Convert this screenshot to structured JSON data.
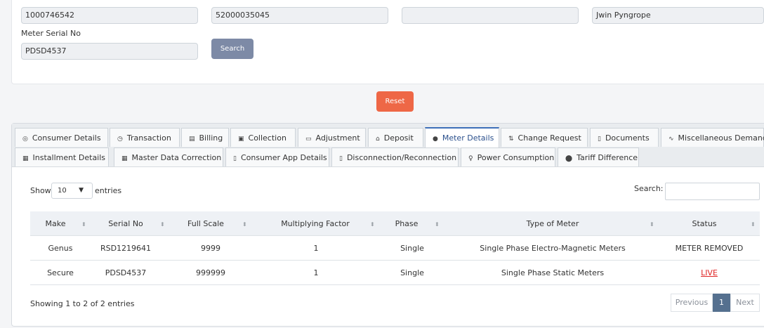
{
  "form": {
    "field1_value": "1000746542",
    "field2_value": "52000035045",
    "field3_value": "",
    "field4_value": "Jwin  Pyngrope",
    "meter_serial_label": "Meter Serial No",
    "meter_serial_value": "PDSD4537",
    "search_button": "Search",
    "reset_button": "Reset"
  },
  "tabs": [
    {
      "label": "Consumer Details",
      "icon": "consumer-icon",
      "glyph": "◎"
    },
    {
      "label": "Transaction",
      "icon": "clock-icon",
      "glyph": "◷"
    },
    {
      "label": "Billing",
      "icon": "billing-icon",
      "glyph": "▤"
    },
    {
      "label": "Collection",
      "icon": "collection-icon",
      "glyph": "▣"
    },
    {
      "label": "Adjustment",
      "icon": "adjustment-icon",
      "glyph": "▭"
    },
    {
      "label": "Deposit",
      "icon": "bank-icon",
      "glyph": "⌂"
    },
    {
      "label": "Meter Details",
      "icon": "meter-icon",
      "glyph": "●"
    },
    {
      "label": "Change Request",
      "icon": "change-icon",
      "glyph": "⇅"
    },
    {
      "label": "Documents",
      "icon": "document-icon",
      "glyph": "▯"
    },
    {
      "label": "Miscellaneous Demand",
      "icon": "pulse-icon",
      "glyph": "∿"
    },
    {
      "label": "Installment Details",
      "icon": "installment-icon",
      "glyph": "▦"
    },
    {
      "label": "Master Data Correction",
      "icon": "master-data-icon",
      "glyph": "▦"
    },
    {
      "label": "Consumer App Details",
      "icon": "mobile-icon",
      "glyph": "▯"
    },
    {
      "label": "Disconnection/Reconnection",
      "icon": "plug-icon",
      "glyph": "▯"
    },
    {
      "label": "Power Consumption",
      "icon": "bulb-icon",
      "glyph": "♀"
    },
    {
      "label": "Tariff Difference",
      "icon": "circle-icon",
      "glyph": "⬤"
    }
  ],
  "active_tab": "Meter Details",
  "table": {
    "show_label": "Show",
    "entries_value": "10",
    "entries_label": "entries",
    "search_label": "Search:",
    "columns": [
      "Make",
      "Serial No",
      "Full Scale",
      "Multiplying Factor",
      "Phase",
      "Type of Meter",
      "Status"
    ],
    "rows": [
      [
        "Genus",
        "RSD1219641",
        "9999",
        "1",
        "Single",
        "Single Phase Electro-Magnetic Meters",
        "METER REMOVED"
      ],
      [
        "Secure",
        "PDSD4537",
        "999999",
        "1",
        "Single",
        "Single Phase Static Meters",
        "LIVE"
      ]
    ],
    "info": "Showing 1 to 2 of 2 entries",
    "previous": "Previous",
    "page": "1",
    "next": "Next"
  },
  "colors": {
    "active_tab": "#3d6fb8",
    "reset": "#ee6746",
    "search": "#7d8aa6",
    "live": "#e02424"
  }
}
